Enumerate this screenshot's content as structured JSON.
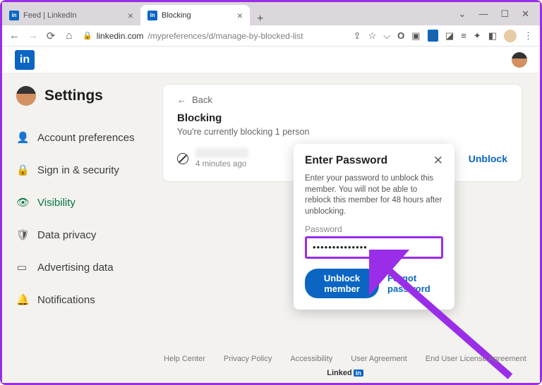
{
  "browser": {
    "tabs": [
      {
        "title": "Feed | LinkedIn",
        "active": false
      },
      {
        "title": "Blocking",
        "active": true
      }
    ],
    "url_host": "linkedin.com",
    "url_path": "/mypreferences/d/manage-by-blocked-list"
  },
  "sidebar": {
    "title": "Settings",
    "items": [
      {
        "label": "Account preferences",
        "icon": "person-icon"
      },
      {
        "label": "Sign in & security",
        "icon": "lock-icon"
      },
      {
        "label": "Visibility",
        "icon": "eye-icon"
      },
      {
        "label": "Data privacy",
        "icon": "shield-icon"
      },
      {
        "label": "Advertising data",
        "icon": "ad-icon"
      },
      {
        "label": "Notifications",
        "icon": "bell-icon"
      }
    ],
    "active_index": 2
  },
  "main": {
    "back_label": "Back",
    "heading": "Blocking",
    "subheading": "You're currently blocking 1 person",
    "blocked": {
      "when": "4 minutes ago",
      "unblock_label": "Unblock"
    }
  },
  "modal": {
    "title": "Enter Password",
    "body": "Enter your password to unblock this member. You will not be able to reblock this member for 48 hours after unblocking.",
    "password_label": "Password",
    "password_value": "••••••••••••••",
    "primary_label": "Unblock member",
    "forgot_label": "Forgot password"
  },
  "footer": {
    "links": [
      "Help Center",
      "Privacy Policy",
      "Accessibility",
      "User Agreement",
      "End User License Agreement"
    ],
    "brand": "Linked"
  },
  "colors": {
    "accent": "#0a66c2",
    "highlight": "#9a2ee8",
    "active_nav": "#057642"
  }
}
